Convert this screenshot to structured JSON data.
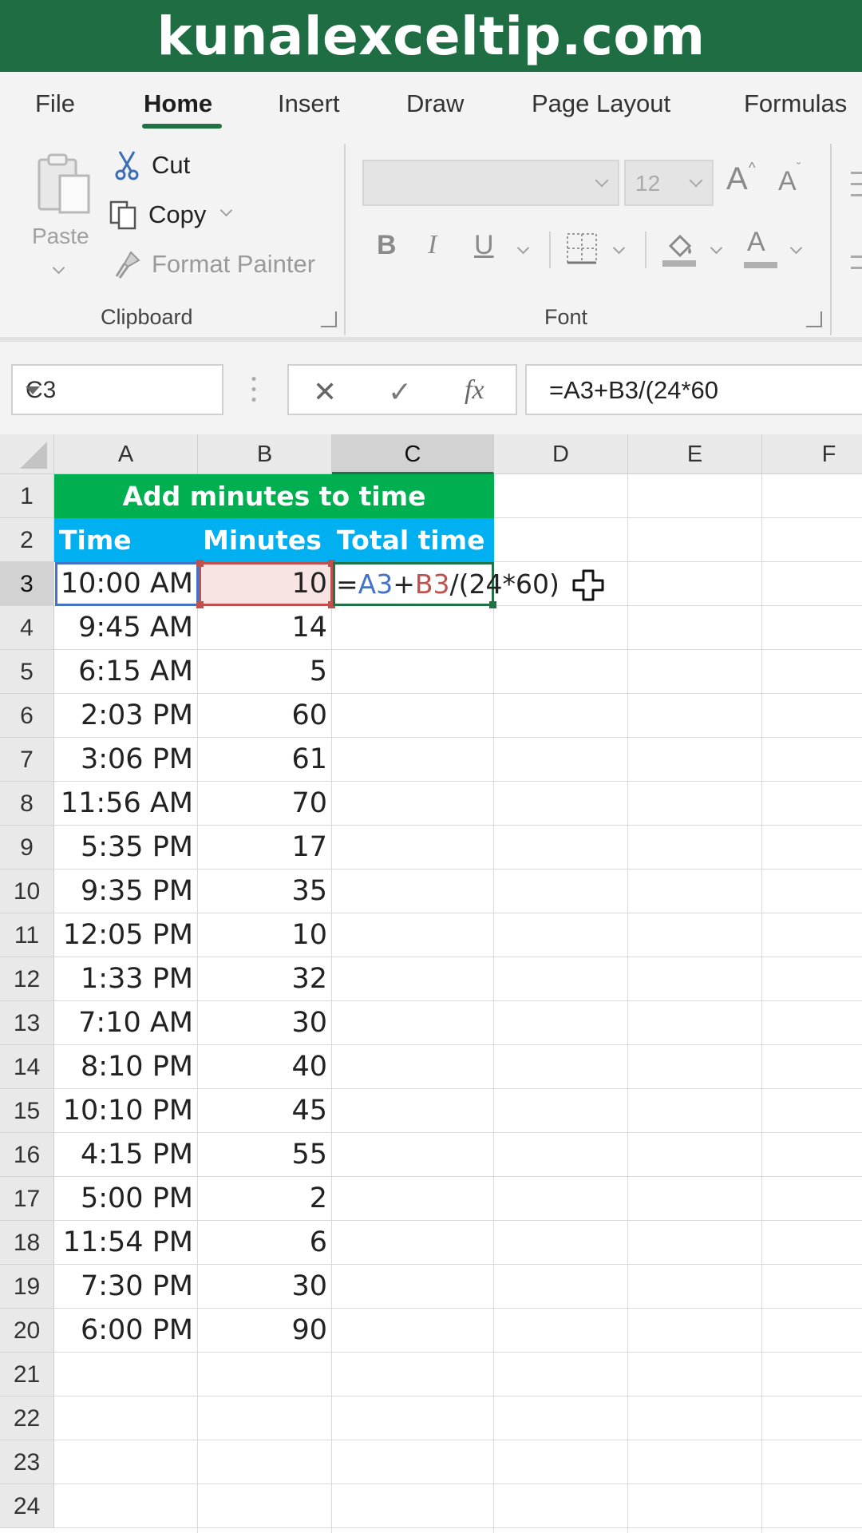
{
  "banner": {
    "text": "kunalexceltip.com"
  },
  "ribbon": {
    "tabs": [
      "File",
      "Home",
      "Insert",
      "Draw",
      "Page Layout",
      "Formulas"
    ],
    "active_tab": "Home",
    "clipboard": {
      "paste_label": "Paste",
      "cut_label": "Cut",
      "copy_label": "Copy",
      "format_painter_label": "Format Painter",
      "group_label": "Clipboard"
    },
    "font": {
      "font_name": "",
      "font_size": "12",
      "bold": "B",
      "italic": "I",
      "underline": "U",
      "grow": "A",
      "shrink": "A",
      "font_color": "A",
      "group_label": "Font"
    }
  },
  "formula_bar": {
    "name_box": "C3",
    "cancel_symbol": "✕",
    "enter_symbol": "✓",
    "fx_symbol": "fx",
    "formula": "=A3+B3/(24*60"
  },
  "sheet": {
    "columns": [
      "A",
      "B",
      "C",
      "D",
      "E",
      "F"
    ],
    "selected_column": "C",
    "rows": [
      "1",
      "2",
      "3",
      "4",
      "5",
      "6",
      "7",
      "8",
      "9",
      "10",
      "11",
      "12",
      "13",
      "14",
      "15",
      "16",
      "17",
      "18",
      "19",
      "20",
      "21",
      "22",
      "23",
      "24"
    ],
    "selected_row": "3",
    "title": "Add minutes to time",
    "headers": {
      "time": "Time",
      "minutes": "Minutes",
      "total": "Total time"
    },
    "data": [
      {
        "time": "10:00 AM",
        "minutes": "10"
      },
      {
        "time": "9:45 AM",
        "minutes": "14"
      },
      {
        "time": "6:15 AM",
        "minutes": "5"
      },
      {
        "time": "2:03 PM",
        "minutes": "60"
      },
      {
        "time": "3:06 PM",
        "minutes": "61"
      },
      {
        "time": "11:56 AM",
        "minutes": "70"
      },
      {
        "time": "5:35 PM",
        "minutes": "17"
      },
      {
        "time": "9:35 PM",
        "minutes": "35"
      },
      {
        "time": "12:05 PM",
        "minutes": "10"
      },
      {
        "time": "1:33 PM",
        "minutes": "32"
      },
      {
        "time": "7:10 AM",
        "minutes": "30"
      },
      {
        "time": "8:10 PM",
        "minutes": "40"
      },
      {
        "time": "10:10 PM",
        "minutes": "45"
      },
      {
        "time": "4:15 PM",
        "minutes": "55"
      },
      {
        "time": "5:00 PM",
        "minutes": "2"
      },
      {
        "time": "11:54 PM",
        "minutes": "6"
      },
      {
        "time": "7:30 PM",
        "minutes": "30"
      },
      {
        "time": "6:00 PM",
        "minutes": "90"
      }
    ],
    "editing_formula": {
      "eq": "=",
      "ref1": "A3",
      "plus": "+",
      "ref2": "B3",
      "rest": "/(24*60)"
    },
    "colors": {
      "title_fill": "#00b050",
      "header_fill": "#00b0f0",
      "ref_a3": "#4472c4",
      "ref_b3": "#c0504d",
      "active_border": "#217346"
    }
  }
}
